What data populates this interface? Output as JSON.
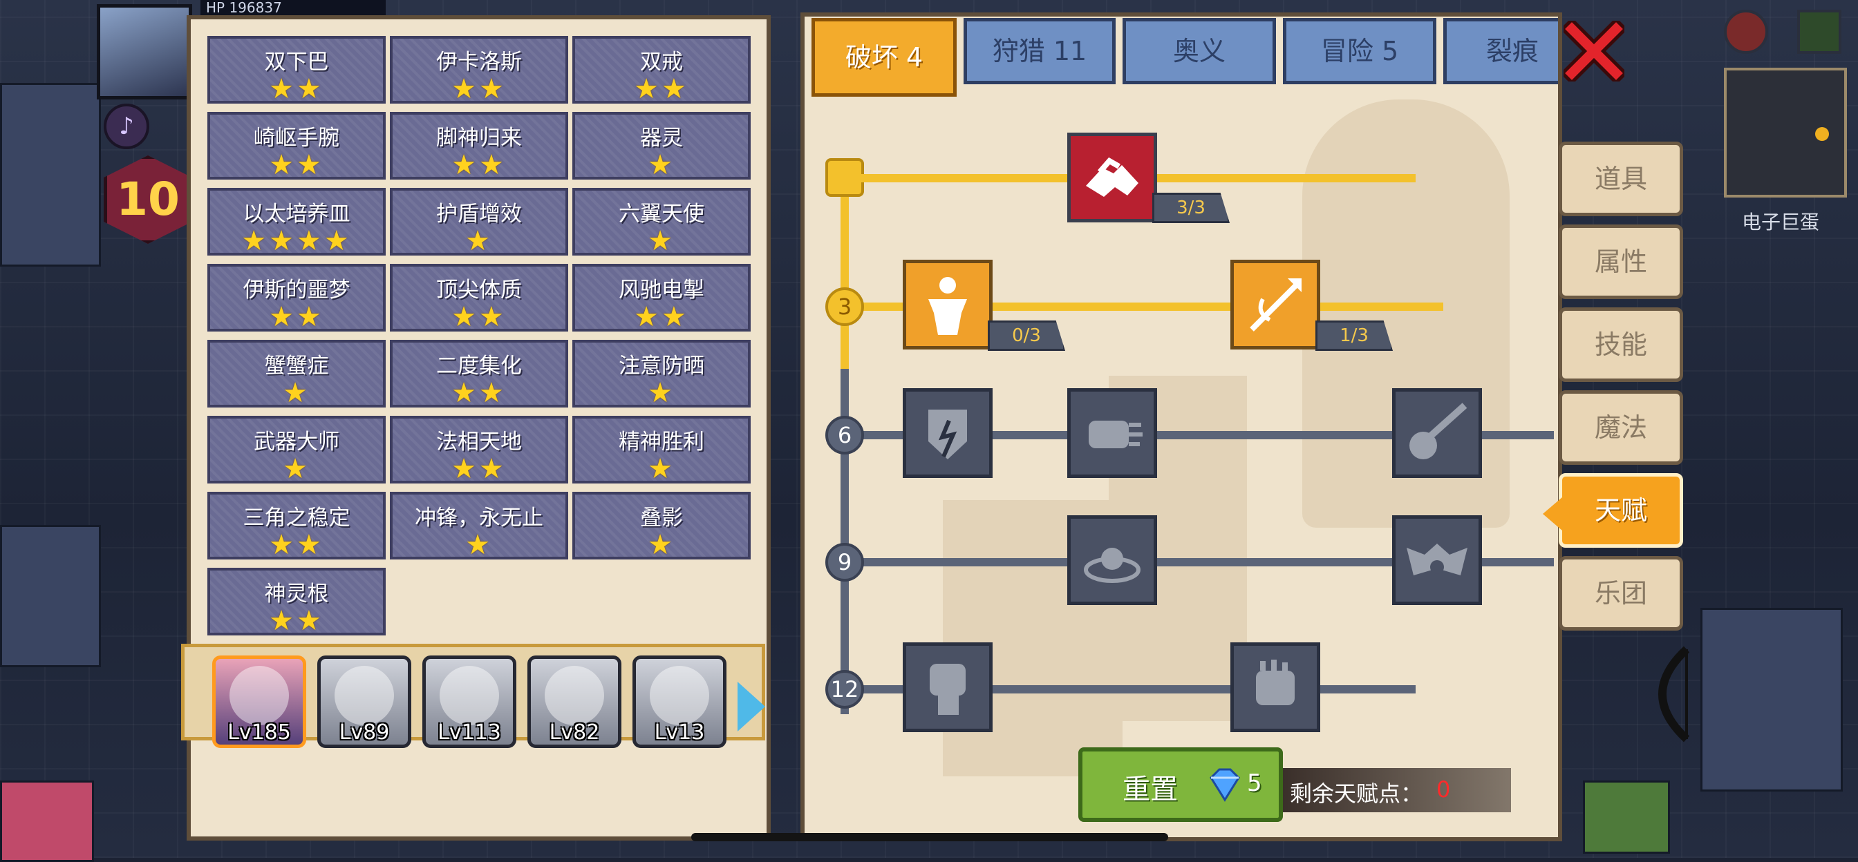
{
  "hud": {
    "hp_text": "HP  196837",
    "level": "10"
  },
  "traits": [
    {
      "name": "双下巴",
      "stars": "★★"
    },
    {
      "name": "伊卡洛斯",
      "stars": "★★"
    },
    {
      "name": "双戒",
      "stars": "★★"
    },
    {
      "name": "崎岖手腕",
      "stars": "★★"
    },
    {
      "name": "脚神归来",
      "stars": "★★"
    },
    {
      "name": "器灵",
      "stars": "★"
    },
    {
      "name": "以太培养皿",
      "stars": "★★★★"
    },
    {
      "name": "护盾增效",
      "stars": "★"
    },
    {
      "name": "六翼天使",
      "stars": "★"
    },
    {
      "name": "伊斯的噩梦",
      "stars": "★★"
    },
    {
      "name": "顶尖体质",
      "stars": "★★"
    },
    {
      "name": "风驰电掣",
      "stars": "★★"
    },
    {
      "name": "蟹蟹症",
      "stars": "★"
    },
    {
      "name": "二度集化",
      "stars": "★★"
    },
    {
      "name": "注意防晒",
      "stars": "★"
    },
    {
      "name": "武器大师",
      "stars": "★"
    },
    {
      "name": "法相天地",
      "stars": "★★"
    },
    {
      "name": "精神胜利",
      "stars": "★"
    },
    {
      "name": "三角之稳定",
      "stars": "★★"
    },
    {
      "name": "冲锋，永无止",
      "stars": "★"
    },
    {
      "name": "叠影",
      "stars": "★"
    },
    {
      "name": "神灵根",
      "stars": "★★"
    }
  ],
  "heroes": [
    {
      "level": "Lv185"
    },
    {
      "level": "Lv89"
    },
    {
      "level": "Lv113"
    },
    {
      "level": "Lv82"
    },
    {
      "level": "Lv13"
    }
  ],
  "tabs": [
    "破坏 4",
    "狩猎 11",
    "奥义",
    "冒险 5",
    "裂痕"
  ],
  "talent_tree": {
    "row_markers": [
      "3",
      "6",
      "9",
      "12"
    ],
    "counts": {
      "top": "3/3",
      "left": "0/3",
      "right": "1/3"
    }
  },
  "reset": {
    "label": "重置",
    "cost": "5"
  },
  "remaining": {
    "label": "剩余天赋点：",
    "value": "0"
  },
  "side_menu": [
    "道具",
    "属性",
    "技能",
    "魔法",
    "天赋",
    "乐团"
  ],
  "minimap_label": "电子巨蛋",
  "colors": {
    "gold": "#f3c12c",
    "accent": "#f6a21e",
    "tab_blue": "#6f90c4",
    "panel": "#efe3cc"
  }
}
